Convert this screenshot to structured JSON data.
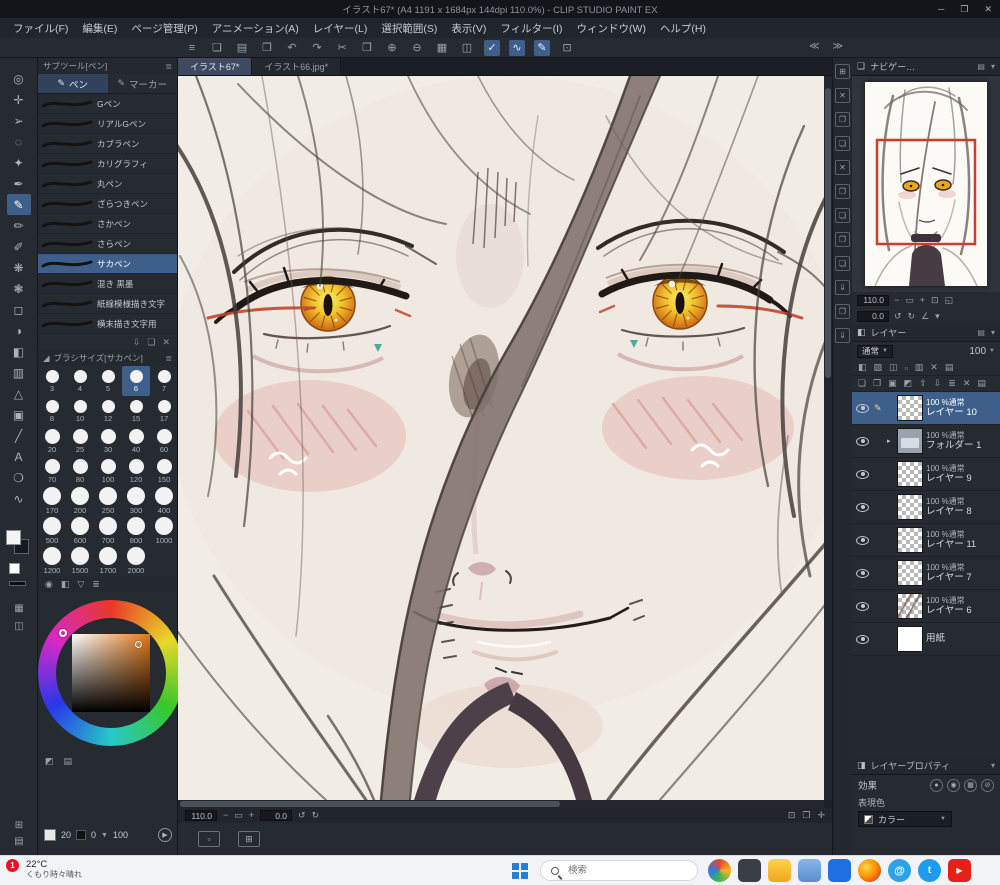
{
  "colors": {
    "accent_blue": "#3e5f8a",
    "titlebar_bg": "#13151a",
    "panel_bg": "#262a31",
    "taskbar_bg": "#f2f3f6",
    "badge_red": "#e81224",
    "iris_yellow": "#f2c22c",
    "iris_orange": "#d8801a",
    "eyeliner_red": "#c2452c",
    "canvas_bg": "#f1ede5",
    "navigator_view_rect": "#d23a2c"
  },
  "window": {
    "title": "イラスト67* (A4 1191 x 1684px 144dpi 110.0%) - CLIP STUDIO PAINT EX",
    "controls": {
      "min": "─",
      "max": "❐",
      "close": "✕"
    }
  },
  "menu": {
    "items": [
      "ファイル(F)",
      "編集(E)",
      "ページ管理(P)",
      "アニメーション(A)",
      "レイヤー(L)",
      "選択範囲(S)",
      "表示(V)",
      "フィルター(I)",
      "ウィンドウ(W)",
      "ヘルプ(H)"
    ]
  },
  "toolbar": {
    "icons": [
      {
        "g": "≡"
      },
      {
        "g": "❏"
      },
      {
        "g": "▤"
      },
      {
        "g": "❐"
      },
      {
        "g": "↶"
      },
      {
        "g": "↷"
      },
      {
        "g": "✂"
      },
      {
        "g": "❒"
      },
      {
        "g": "⊕"
      },
      {
        "g": "⊖"
      },
      {
        "g": "▦"
      },
      {
        "g": "◫"
      },
      {
        "g": "✓",
        "sel": true
      },
      {
        "g": "∿",
        "sel": true
      },
      {
        "g": "✎",
        "sel": true
      },
      {
        "g": "⊡"
      }
    ],
    "overflow_arrows": "≪ ≫"
  },
  "tools": [
    {
      "name": "zoom-tool",
      "g": "◎"
    },
    {
      "name": "move-tool",
      "g": "✛"
    },
    {
      "name": "object-tool",
      "g": "➢"
    },
    {
      "name": "selection-tool",
      "g": "◌"
    },
    {
      "name": "auto-select-tool",
      "g": "✦"
    },
    {
      "name": "eyedropper-tool",
      "g": "✒"
    },
    {
      "name": "pen-tool",
      "g": "✎",
      "sel": true
    },
    {
      "name": "pencil-tool",
      "g": "✏"
    },
    {
      "name": "brush-tool",
      "g": "✐"
    },
    {
      "name": "airbrush-tool",
      "g": "❋"
    },
    {
      "name": "decoration-tool",
      "g": "❃"
    },
    {
      "name": "eraser-tool",
      "g": "◻"
    },
    {
      "name": "blend-tool",
      "g": "◑"
    },
    {
      "name": "fill-tool",
      "g": "◧"
    },
    {
      "name": "gradient-tool",
      "g": "▥"
    },
    {
      "name": "figure-tool",
      "g": "△"
    },
    {
      "name": "frame-tool",
      "g": "▣"
    },
    {
      "name": "ruler-tool",
      "g": "╱"
    },
    {
      "name": "text-tool",
      "g": "A"
    },
    {
      "name": "balloon-tool",
      "g": "❍"
    },
    {
      "name": "correction-tool",
      "g": "∿"
    }
  ],
  "subtool": {
    "title": "サブツール[ペン]",
    "tabs": [
      {
        "label": "ペン",
        "active": true
      },
      {
        "label": "マーカー"
      }
    ],
    "brushes": [
      {
        "label": "Gペン"
      },
      {
        "label": "リアルGペン"
      },
      {
        "label": "カブラペン"
      },
      {
        "label": "カリグラフィ"
      },
      {
        "label": "丸ペン"
      },
      {
        "label": "ざらつきペン"
      },
      {
        "label": "さかペン"
      },
      {
        "label": "さらペン"
      },
      {
        "label": "サカペン",
        "sel": true
      },
      {
        "label": "混き 黒墨"
      },
      {
        "label": "紙線模様描き文字"
      },
      {
        "label": "横末描き文字用"
      }
    ],
    "foot_icons": [
      {
        "g": "⇩"
      },
      {
        "g": "❏"
      },
      {
        "g": "✕"
      }
    ]
  },
  "brushsize": {
    "title": "ブラシサイズ[サカペン]",
    "values": [
      {
        "v": "3"
      },
      {
        "v": "4"
      },
      {
        "v": "5"
      },
      {
        "v": "6",
        "sel": true
      },
      {
        "v": "7"
      },
      {
        "v": "8"
      },
      {
        "v": "10"
      },
      {
        "v": "12"
      },
      {
        "v": "15"
      },
      {
        "v": "17"
      },
      {
        "v": "20"
      },
      {
        "v": "25"
      },
      {
        "v": "30"
      },
      {
        "v": "40"
      },
      {
        "v": "60"
      },
      {
        "v": "70"
      },
      {
        "v": "80"
      },
      {
        "v": "100"
      },
      {
        "v": "120"
      },
      {
        "v": "150"
      },
      {
        "v": "170"
      },
      {
        "v": "200"
      },
      {
        "v": "250"
      },
      {
        "v": "300"
      },
      {
        "v": "400"
      },
      {
        "v": "500"
      },
      {
        "v": "600"
      },
      {
        "v": "700"
      },
      {
        "v": "800"
      },
      {
        "v": "1000"
      },
      {
        "v": "1200"
      },
      {
        "v": "1500"
      },
      {
        "v": "1700"
      },
      {
        "v": "2000"
      }
    ]
  },
  "colorpanel": {
    "head_icons": [
      {
        "g": "◉"
      },
      {
        "g": "◧"
      },
      {
        "g": "▽"
      },
      {
        "g": "≣"
      }
    ],
    "foot_icons": [
      {
        "g": "◩"
      },
      {
        "g": "▤"
      }
    ],
    "values": [
      "20",
      "0",
      "100"
    ],
    "play_icon": "▶"
  },
  "doc_tabs": [
    {
      "label": "イラスト67*",
      "active": true
    },
    {
      "label": "イラスト66.jpg*"
    }
  ],
  "statusbar": {
    "zoom": "110.0",
    "angle": "0.0",
    "zoom_icons": [
      {
        "g": "−"
      },
      {
        "g": "▭"
      },
      {
        "g": "+"
      }
    ],
    "angle_icons": [
      {
        "g": "↺"
      },
      {
        "g": "↻"
      }
    ],
    "right_icons": [
      {
        "g": "⊡"
      },
      {
        "g": "❐"
      },
      {
        "g": "✛"
      }
    ]
  },
  "canvas_launcher_icons": [
    {
      "g": "▫"
    },
    {
      "g": "⊞"
    }
  ],
  "dock_icons": [
    {
      "g": "⊞"
    },
    {
      "g": "✕"
    },
    {
      "g": "❐"
    },
    {
      "g": "❏"
    },
    {
      "g": "✕"
    },
    {
      "g": "❐"
    },
    {
      "g": "❏"
    },
    {
      "g": "❐"
    },
    {
      "g": "❏"
    },
    {
      "g": "⇓"
    },
    {
      "g": "❐"
    },
    {
      "g": "⇓"
    }
  ],
  "navigator": {
    "title": "ナビゲーター",
    "zoom": "110.0",
    "angle": "0.0",
    "zoom_icons": [
      {
        "g": "−"
      },
      {
        "g": "▭"
      },
      {
        "g": "+"
      },
      {
        "g": "⊡"
      },
      {
        "g": "◱"
      }
    ],
    "angle_icons": [
      {
        "g": "↺"
      },
      {
        "g": "↻"
      },
      {
        "g": "∠"
      },
      {
        "g": "▾"
      }
    ]
  },
  "layer_panel": {
    "tab": "レイヤー",
    "blend": "通常",
    "opacity": "100",
    "icon_row1": [
      {
        "g": "◧"
      },
      {
        "g": "▨"
      },
      {
        "g": "◫"
      },
      {
        "g": "▫"
      },
      {
        "g": "▥"
      },
      {
        "g": "✕"
      },
      {
        "g": "▤"
      }
    ],
    "icon_row2": [
      {
        "g": "❏"
      },
      {
        "g": "❐"
      },
      {
        "g": "▣"
      },
      {
        "g": "◩"
      },
      {
        "g": "⇧"
      },
      {
        "g": "⇩"
      },
      {
        "g": "≣"
      },
      {
        "g": "✕"
      },
      {
        "g": "▤"
      }
    ],
    "items": [
      {
        "info": "100 %通常",
        "name": "レイヤー 10",
        "sel": true,
        "editing": true
      },
      {
        "info": "100 %通常",
        "name": "フォルダー 1",
        "folder": true
      },
      {
        "info": "100 %通常",
        "name": "レイヤー 9"
      },
      {
        "info": "100 %通常",
        "name": "レイヤー 8"
      },
      {
        "info": "100 %通常",
        "name": "レイヤー 11"
      },
      {
        "info": "100 %通常",
        "name": "レイヤー 7"
      },
      {
        "info": "100 %通常",
        "name": "レイヤー 6",
        "art": true
      },
      {
        "info": "",
        "name": "用紙",
        "paper": true
      }
    ]
  },
  "layer_property": {
    "title": "レイヤープロパティ",
    "effect_label": "効果",
    "effect_icons": [
      {
        "g": "●"
      },
      {
        "g": "◉"
      },
      {
        "g": "▦"
      },
      {
        "g": "⊘"
      }
    ],
    "expression_label": "表現色",
    "color_button_label": "カラー"
  },
  "taskbar": {
    "badge": "1",
    "temp": "22°C",
    "weather": "くもり時々晴れ",
    "search_placeholder": "検索",
    "app_icons": [
      "colorful-app",
      "system-app",
      "file-explorer",
      "folder-app",
      "blue-app",
      "firefox",
      "mail",
      "twitter",
      "youtube"
    ]
  }
}
